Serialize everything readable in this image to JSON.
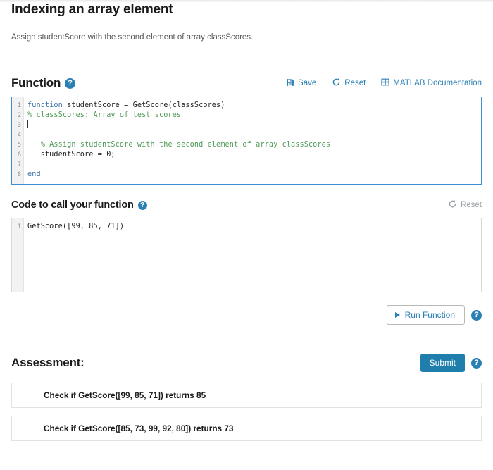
{
  "page": {
    "title": "Indexing an array element",
    "subtitle": "Assign studentScore with the second element of array classScores."
  },
  "function_section": {
    "heading": "Function",
    "help_icon": "help-icon",
    "help_glyph": "?",
    "toolbar": {
      "save_label": "Save",
      "save_icon": "save-floppy-icon",
      "reset_label": "Reset",
      "reset_icon": "reset-circular-arrow-icon",
      "docs_label": "MATLAB Documentation",
      "docs_icon": "matlab-documentation-icon"
    },
    "editor": {
      "focused": true,
      "line_numbers": [
        "1",
        "2",
        "3",
        "4",
        "5",
        "6",
        "7",
        "8"
      ],
      "lines": [
        {
          "n": "1",
          "segments": [
            {
              "t": "function",
              "c": "kw"
            },
            {
              "t": " studentScore = GetScore(classScores)",
              "c": ""
            }
          ]
        },
        {
          "n": "2",
          "segments": [
            {
              "t": "% classScores: Array of test scores",
              "c": "cmt"
            }
          ]
        },
        {
          "n": "3",
          "segments": [
            {
              "t": "",
              "c": ""
            }
          ],
          "caret": true
        },
        {
          "n": "4",
          "segments": [
            {
              "t": "",
              "c": ""
            }
          ]
        },
        {
          "n": "5",
          "segments": [
            {
              "t": "   % Assign studentScore with the second element of array classScores",
              "c": "cmt"
            }
          ]
        },
        {
          "n": "6",
          "segments": [
            {
              "t": "   studentScore = 0;",
              "c": ""
            }
          ]
        },
        {
          "n": "7",
          "segments": [
            {
              "t": "",
              "c": ""
            }
          ]
        },
        {
          "n": "8",
          "segments": [
            {
              "t": "end",
              "c": "kw"
            }
          ]
        }
      ]
    }
  },
  "call_section": {
    "heading": "Code to call your function",
    "help_glyph": "?",
    "reset_label": "Reset",
    "reset_icon": "reset-circular-arrow-icon",
    "editor": {
      "focused": false,
      "line_numbers": [
        "1"
      ],
      "lines": [
        {
          "n": "1",
          "segments": [
            {
              "t": "GetScore([99, 85, 71])",
              "c": ""
            }
          ]
        }
      ]
    },
    "run_label": "Run Function",
    "run_icon": "play-triangle-icon",
    "run_help_glyph": "?"
  },
  "assessment_section": {
    "heading": "Assessment:",
    "submit_label": "Submit",
    "help_glyph": "?",
    "rows": [
      {
        "label": "Check if GetScore([99, 85, 71]) returns 85"
      },
      {
        "label": "Check if GetScore([85, 73, 99, 92, 80]) returns 73"
      }
    ]
  },
  "colors": {
    "accent": "#2a7fb5",
    "submit": "#1f7eab",
    "editor_focus_border": "#3b8fd4",
    "comment_green": "#4f9a57",
    "keyword_blue": "#3d6fa5"
  }
}
